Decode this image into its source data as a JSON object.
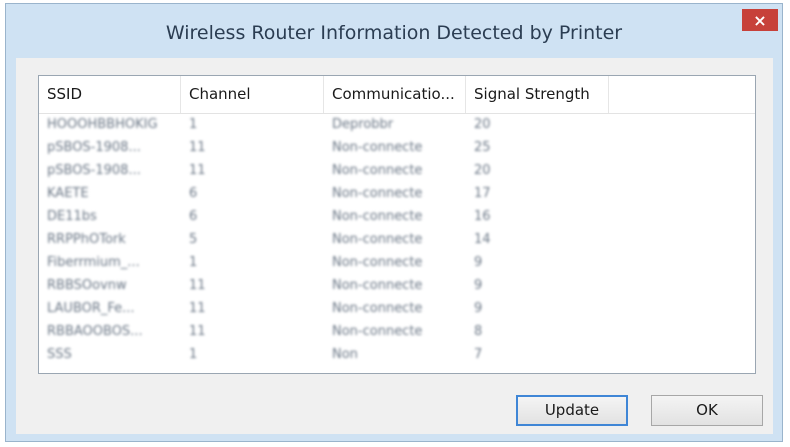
{
  "window": {
    "title": "Wireless Router Information Detected by Printer",
    "close_glyph": "×"
  },
  "list": {
    "columns": [
      "SSID",
      "Channel",
      "Communicatio...",
      "Signal Strength"
    ],
    "rows": [
      {
        "ssid": "HOOOHBBHOKIG",
        "channel": "1",
        "communication": "Deprobbr",
        "signal": "20"
      },
      {
        "ssid": "pSBOS-1908...",
        "channel": "11",
        "communication": "Non-connecte",
        "signal": "25"
      },
      {
        "ssid": "pSBOS-1908...",
        "channel": "11",
        "communication": "Non-connecte",
        "signal": "20"
      },
      {
        "ssid": "KAETE",
        "channel": "6",
        "communication": "Non-connecte",
        "signal": "17"
      },
      {
        "ssid": "DE11bs",
        "channel": "6",
        "communication": "Non-connecte",
        "signal": "16"
      },
      {
        "ssid": "RRPPhOTork",
        "channel": "5",
        "communication": "Non-connecte",
        "signal": "14"
      },
      {
        "ssid": "Fiberrmium_...",
        "channel": "1",
        "communication": "Non-connecte",
        "signal": "9"
      },
      {
        "ssid": "RBBSOovnw",
        "channel": "11",
        "communication": "Non-connecte",
        "signal": "9"
      },
      {
        "ssid": "LAUBOR_Fe...",
        "channel": "11",
        "communication": "Non-connecte",
        "signal": "9"
      },
      {
        "ssid": "RBBAOOBOS...",
        "channel": "11",
        "communication": "Non-connecte",
        "signal": "8"
      },
      {
        "ssid": "SSS",
        "channel": "1",
        "communication": "Non",
        "signal": "7"
      }
    ]
  },
  "buttons": {
    "update_label": "Update",
    "ok_label": "OK"
  }
}
